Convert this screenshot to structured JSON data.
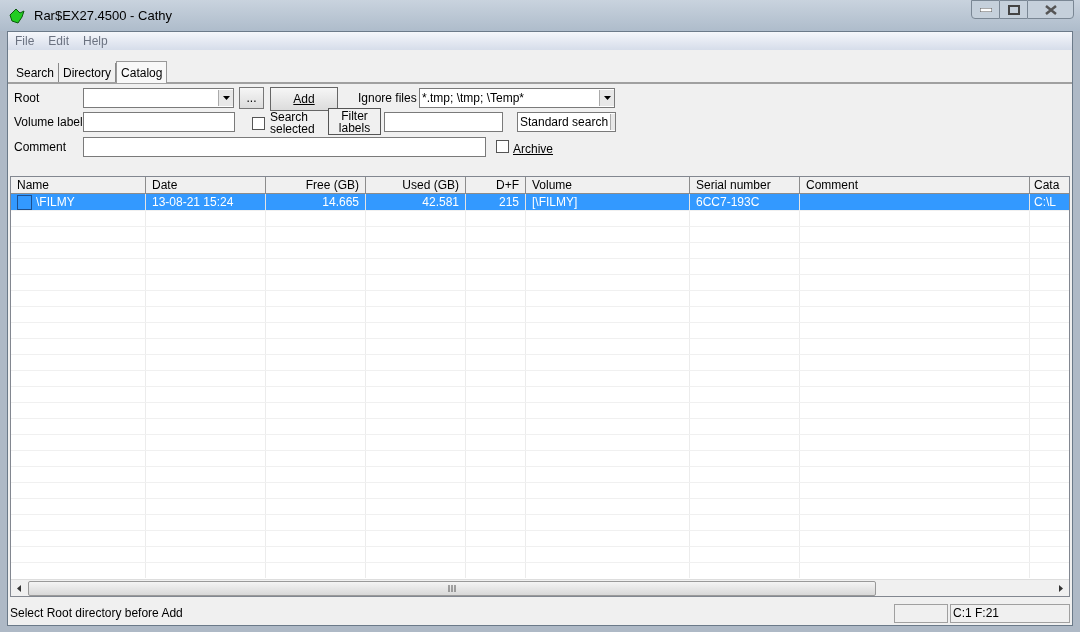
{
  "window": {
    "title": "Rar$EX27.4500 - Cathy"
  },
  "menu": [
    "File",
    "Edit",
    "Help"
  ],
  "tabs": [
    {
      "label": "Search",
      "selected": false
    },
    {
      "label": "Directory",
      "selected": false
    },
    {
      "label": "Catalog",
      "selected": true
    }
  ],
  "form": {
    "root_label": "Root",
    "browse_button": "...",
    "add_button": "Add",
    "ignore_label": "Ignore files",
    "ignore_value": "*.tmp; \\tmp; \\Temp*",
    "volume_label": "Volume label",
    "search_selected": {
      "label_1": "Search",
      "label_2": "selected",
      "checked": false
    },
    "filter_button_1": "Filter",
    "filter_button_2": "labels",
    "search_mode": "Standard search",
    "comment_label": "Comment",
    "archive": {
      "label": "Archive",
      "checked": false
    }
  },
  "table": {
    "columns": [
      {
        "label": "Name",
        "kind": "text"
      },
      {
        "label": "Date",
        "kind": "text"
      },
      {
        "label": "Free (GB)",
        "kind": "number"
      },
      {
        "label": "Used (GB)",
        "kind": "number"
      },
      {
        "label": "D+F",
        "kind": "number"
      },
      {
        "label": "Volume",
        "kind": "text"
      },
      {
        "label": "Serial number",
        "kind": "text"
      },
      {
        "label": "Comment",
        "kind": "text"
      },
      {
        "label": "Cata",
        "kind": "text"
      }
    ],
    "rows": [
      {
        "selected": true,
        "cells": [
          "\\FILMY",
          "13-08-21 15:24",
          "14.665",
          "42.581",
          "215",
          "[\\FILMY]",
          "6CC7-193C",
          "",
          "C:\\L"
        ]
      }
    ]
  },
  "status_bar": {
    "message": "Select Root directory before Add",
    "panel_2": "C:1 F:21"
  }
}
